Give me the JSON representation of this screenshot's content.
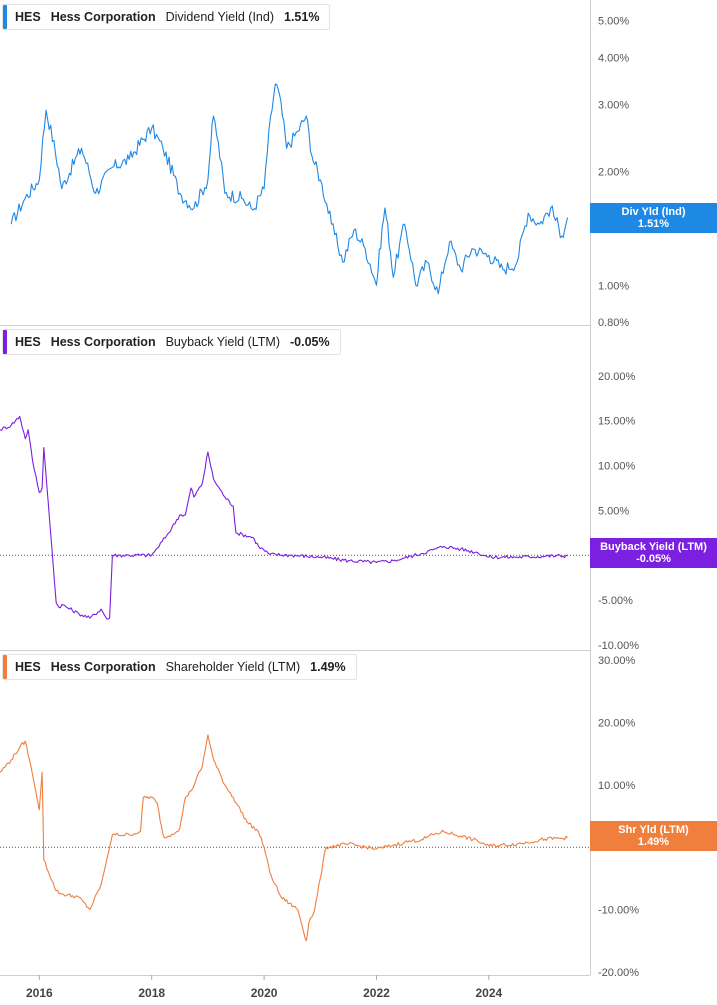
{
  "chart_data": [
    {
      "type": "line",
      "scale": "log",
      "ticker": "HES",
      "company": "Hess Corporation",
      "metric": "Dividend Yield (Ind)",
      "current_value": "1.51%",
      "flag_label": "Div Yld (Ind)",
      "color": "#1e88e5",
      "y_ticks": [
        "5.00%",
        "4.00%",
        "3.00%",
        "2.00%",
        "1.00%",
        "0.80%"
      ],
      "y_tick_values": [
        5.0,
        4.0,
        3.0,
        2.0,
        1.0,
        0.8
      ],
      "ylim": [
        0.8,
        5.4
      ],
      "zero_line": false,
      "series": {
        "x": [
          2015.5,
          2015.75,
          2016.0,
          2016.12,
          2016.4,
          2016.75,
          2017.0,
          2017.3,
          2017.6,
          2018.0,
          2018.2,
          2018.5,
          2018.75,
          2019.0,
          2019.1,
          2019.3,
          2019.6,
          2019.8,
          2020.0,
          2020.2,
          2020.25,
          2020.4,
          2020.6,
          2020.75,
          2020.85,
          2021.0,
          2021.2,
          2021.4,
          2021.6,
          2021.8,
          2022.0,
          2022.15,
          2022.3,
          2022.5,
          2022.7,
          2022.9,
          2023.1,
          2023.3,
          2023.5,
          2023.7,
          2024.0,
          2024.25,
          2024.5,
          2024.7,
          2024.9,
          2025.1,
          2025.3,
          2025.4
        ],
        "y": [
          1.45,
          1.7,
          1.9,
          2.9,
          1.8,
          2.3,
          1.75,
          2.05,
          2.15,
          2.6,
          2.3,
          1.75,
          1.6,
          1.9,
          2.8,
          1.75,
          1.7,
          1.58,
          1.8,
          3.4,
          3.3,
          2.3,
          2.55,
          2.8,
          2.2,
          1.9,
          1.45,
          1.15,
          1.4,
          1.25,
          1.0,
          1.6,
          1.05,
          1.45,
          1.0,
          1.15,
          0.95,
          1.3,
          1.1,
          1.25,
          1.2,
          1.1,
          1.15,
          1.55,
          1.45,
          1.6,
          1.35,
          1.51
        ]
      }
    },
    {
      "type": "line",
      "scale": "linear",
      "ticker": "HES",
      "company": "Hess Corporation",
      "metric": "Buyback Yield (LTM)",
      "current_value": "-0.05%",
      "flag_label": "Buyback Yield (LTM)",
      "color": "#7b1fe0",
      "y_ticks": [
        "20.00%",
        "15.00%",
        "10.00%",
        "5.00%",
        "0.00%",
        "-5.00%",
        "-10.00%"
      ],
      "y_tick_values": [
        20,
        15,
        10,
        5,
        0,
        -5,
        -10
      ],
      "ylim": [
        -10,
        24
      ],
      "zero_line": true,
      "series": {
        "x": [
          2015.3,
          2015.5,
          2015.65,
          2015.75,
          2015.8,
          2015.88,
          2016.0,
          2016.05,
          2016.08,
          2016.3,
          2016.35,
          2016.4,
          2016.7,
          2016.9,
          2017.1,
          2017.2,
          2017.25,
          2017.3,
          2017.6,
          2018.0,
          2018.1,
          2018.3,
          2018.5,
          2018.6,
          2018.7,
          2018.75,
          2018.9,
          2019.0,
          2019.1,
          2019.3,
          2019.45,
          2019.5,
          2019.8,
          2019.9,
          2020.1,
          2020.5,
          2021.0,
          2021.5,
          2022.0,
          2022.3,
          2022.5,
          2022.8,
          2023.0,
          2023.2,
          2023.5,
          2023.8,
          2024.0,
          2024.5,
          2025.0,
          2025.4
        ],
        "y": [
          14,
          14.5,
          15.5,
          13,
          14,
          10.5,
          7,
          7.5,
          12,
          -5.3,
          -5.8,
          -5.5,
          -6.5,
          -7,
          -6,
          -7.1,
          -7.0,
          0,
          0,
          0,
          0.8,
          2.5,
          4.5,
          4.5,
          7.5,
          6.5,
          8,
          11.5,
          8.5,
          6.5,
          5.5,
          2.5,
          2.0,
          1.0,
          0.1,
          0.0,
          -0.2,
          -0.6,
          -0.8,
          -0.6,
          -0.3,
          0.2,
          0.6,
          1.0,
          0.7,
          0.3,
          -0.2,
          -0.2,
          -0.1,
          -0.05
        ]
      }
    },
    {
      "type": "line",
      "scale": "linear",
      "ticker": "HES",
      "company": "Hess Corporation",
      "metric": "Shareholder Yield (LTM)",
      "current_value": "1.49%",
      "flag_label": "Shr Yld (LTM)",
      "color": "#f07f3e",
      "y_ticks": [
        "30.00%",
        "20.00%",
        "10.00%",
        "0.00%",
        "-10.00%",
        "-20.00%"
      ],
      "y_tick_values": [
        30,
        20,
        10,
        0,
        -10,
        -20
      ],
      "ylim": [
        -20,
        30
      ],
      "zero_line": true,
      "series": {
        "x": [
          2015.3,
          2015.5,
          2015.65,
          2015.75,
          2015.85,
          2016.0,
          2016.05,
          2016.08,
          2016.3,
          2016.4,
          2016.7,
          2016.9,
          2017.1,
          2017.3,
          2017.6,
          2017.8,
          2017.85,
          2018.0,
          2018.1,
          2018.2,
          2018.25,
          2018.5,
          2018.6,
          2018.7,
          2018.9,
          2019.0,
          2019.1,
          2019.3,
          2019.45,
          2019.7,
          2019.9,
          2020.0,
          2020.1,
          2020.2,
          2020.3,
          2020.45,
          2020.6,
          2020.75,
          2020.8,
          2020.9,
          2021.0,
          2021.1,
          2021.5,
          2022.0,
          2022.3,
          2022.5,
          2022.8,
          2023.0,
          2023.2,
          2023.5,
          2023.8,
          2024.0,
          2024.5,
          2025.0,
          2025.4
        ],
        "y": [
          12,
          14,
          16,
          17,
          13,
          6,
          12,
          -2,
          -7,
          -7.5,
          -8,
          -10,
          -6,
          2,
          2,
          2.5,
          8,
          8,
          7,
          2,
          1.5,
          3,
          8,
          9,
          13,
          18,
          14,
          10,
          8,
          4,
          2.5,
          0,
          -4,
          -6,
          -8,
          -9,
          -10,
          -15,
          -12,
          -10,
          -5,
          0,
          0.5,
          -0.3,
          0.3,
          0.8,
          1.2,
          2.0,
          2.5,
          1.8,
          1.0,
          0.2,
          0.5,
          1.3,
          1.49
        ]
      }
    }
  ],
  "x_axis": {
    "ticks": [
      "2016",
      "2018",
      "2020",
      "2022",
      "2024"
    ],
    "tick_values": [
      2016,
      2018,
      2020,
      2022,
      2024
    ],
    "xlim": [
      2015.3,
      2025.8
    ]
  }
}
